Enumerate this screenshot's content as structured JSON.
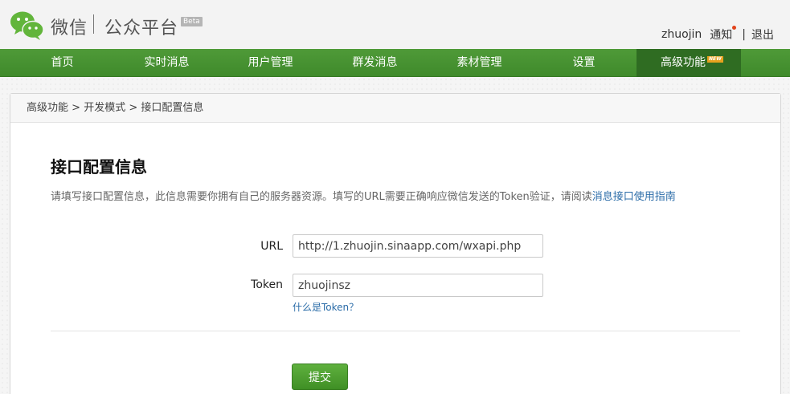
{
  "header": {
    "brand_main": "微信",
    "brand_sub": "公众平台",
    "beta_badge": "Beta",
    "username": "zhuojin",
    "notifications_label": "通知",
    "divider": "|",
    "logout_label": "退出"
  },
  "nav": {
    "items": [
      {
        "label": "首页"
      },
      {
        "label": "实时消息"
      },
      {
        "label": "用户管理"
      },
      {
        "label": "群发消息"
      },
      {
        "label": "素材管理"
      },
      {
        "label": "设置"
      },
      {
        "label": "高级功能",
        "badge": "NEW",
        "active": true
      }
    ]
  },
  "breadcrumb": {
    "level1": "高级功能",
    "sep": ">",
    "level2": "开发模式",
    "level3": "接口配置信息"
  },
  "main": {
    "title": "接口配置信息",
    "description": "请填写接口配置信息，此信息需要你拥有自己的服务器资源。填写的URL需要正确响应微信发送的Token验证，请阅读",
    "description_link": "消息接口使用指南",
    "url_label": "URL",
    "url_value": "http://1.zhuojin.sinaapp.com/wxapi.php",
    "token_label": "Token",
    "token_value": "zhuojinsz",
    "token_help": "什么是Token？",
    "submit_label": "提交"
  },
  "colors": {
    "nav_green": "#45922f",
    "nav_active": "#2f6c22",
    "link_blue": "#2b6ca8",
    "notice_dot": "#e2431b",
    "new_badge": "#e7a21e"
  }
}
